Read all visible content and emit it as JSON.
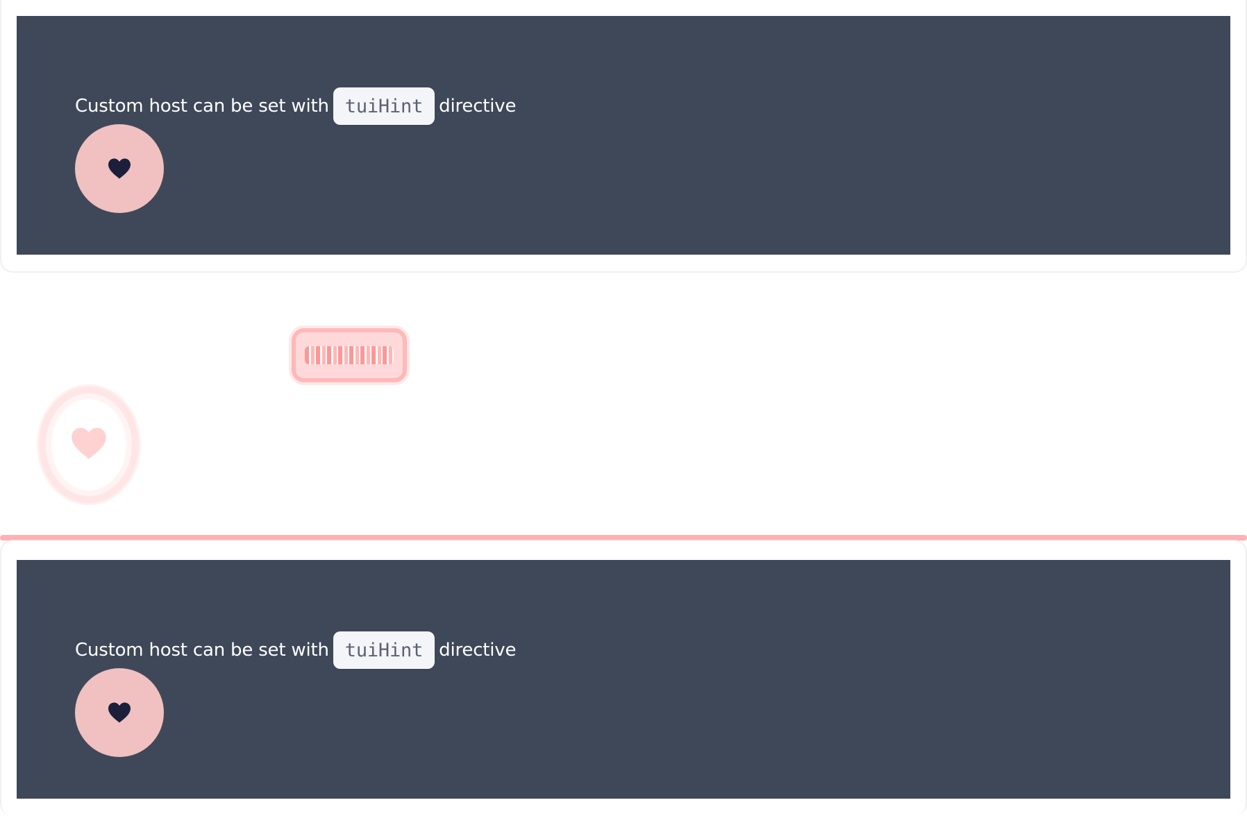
{
  "top_panel": {
    "text_before": "Custom host can be set with",
    "code": "tuiHint",
    "text_after": "directive",
    "button_icon": "heart-icon"
  },
  "diff": {
    "chip_icon": "scribble",
    "circle_icon": "heart-icon"
  },
  "bottom_panel": {
    "text_before": "Custom host can be set with",
    "code": "tuiHint",
    "text_after": "directive",
    "button_icon": "heart-icon"
  },
  "colors": {
    "panel_bg": "#3f4859",
    "button_bg": "#f0c1c0",
    "heart": "#1b1f3b",
    "diff_highlight": "#ffb0b0"
  }
}
